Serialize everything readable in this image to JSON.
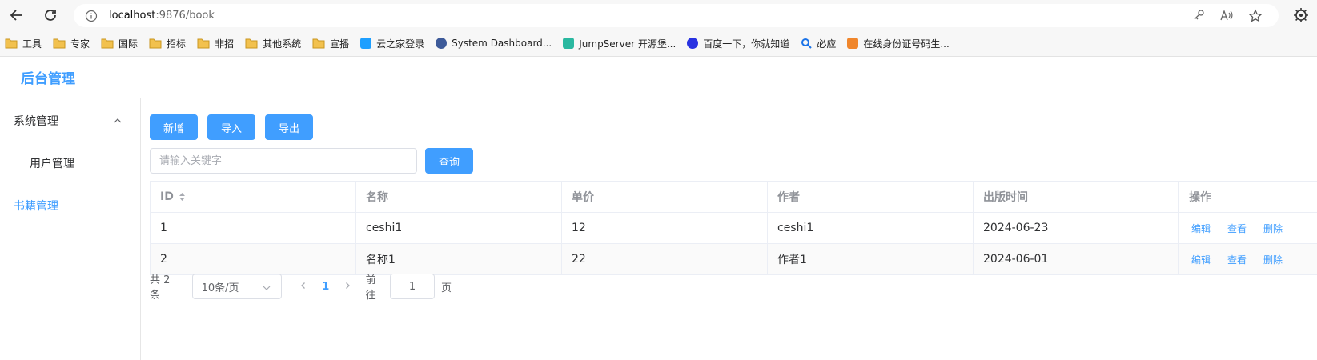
{
  "browser": {
    "url_host": "localhost",
    "url_rest": ":9876/book",
    "bookmarks": [
      {
        "label": "工具",
        "icon": "folder-icon"
      },
      {
        "label": "专家",
        "icon": "folder-icon"
      },
      {
        "label": "国际",
        "icon": "folder-icon"
      },
      {
        "label": "招标",
        "icon": "folder-icon"
      },
      {
        "label": "非招",
        "icon": "folder-icon"
      },
      {
        "label": "其他系统",
        "icon": "folder-icon"
      },
      {
        "label": "宣播",
        "icon": "folder-icon"
      },
      {
        "label": "云之家登录",
        "icon": "cloud-icon"
      },
      {
        "label": "System Dashboard...",
        "icon": "dashboard-icon"
      },
      {
        "label": "JumpServer 开源堡...",
        "icon": "jumpserver-icon"
      },
      {
        "label": "百度一下，你就知道",
        "icon": "baidu-icon"
      },
      {
        "label": "必应",
        "icon": "bing-icon"
      },
      {
        "label": "在线身份证号码生...",
        "icon": "id-card-icon"
      }
    ]
  },
  "app": {
    "title": "后台管理"
  },
  "sidebar": {
    "group_label": "系统管理",
    "sub_item_label": "用户管理",
    "item_label": "书籍管理"
  },
  "toolbar": {
    "add_label": "新增",
    "import_label": "导入",
    "export_label": "导出",
    "search_placeholder": "请输入关键字",
    "query_label": "查询"
  },
  "table": {
    "headers": [
      "ID",
      "名称",
      "单价",
      "作者",
      "出版时间",
      "操作"
    ],
    "rows": [
      {
        "id": "1",
        "name": "ceshi1",
        "price": "12",
        "author": "ceshi1",
        "date": "2024-06-23"
      },
      {
        "id": "2",
        "name": "名称1",
        "price": "22",
        "author": "作者1",
        "date": "2024-06-01"
      }
    ],
    "actions": {
      "edit": "编辑",
      "view": "查看",
      "delete": "删除"
    }
  },
  "pagination": {
    "total_text": "共 2 条",
    "page_size": "10条/页",
    "current_page": "1",
    "goto_label": "前往",
    "goto_value": "1",
    "page_suffix": "页"
  },
  "colors": {
    "primary": "#409eff",
    "border": "#ebeef5"
  }
}
